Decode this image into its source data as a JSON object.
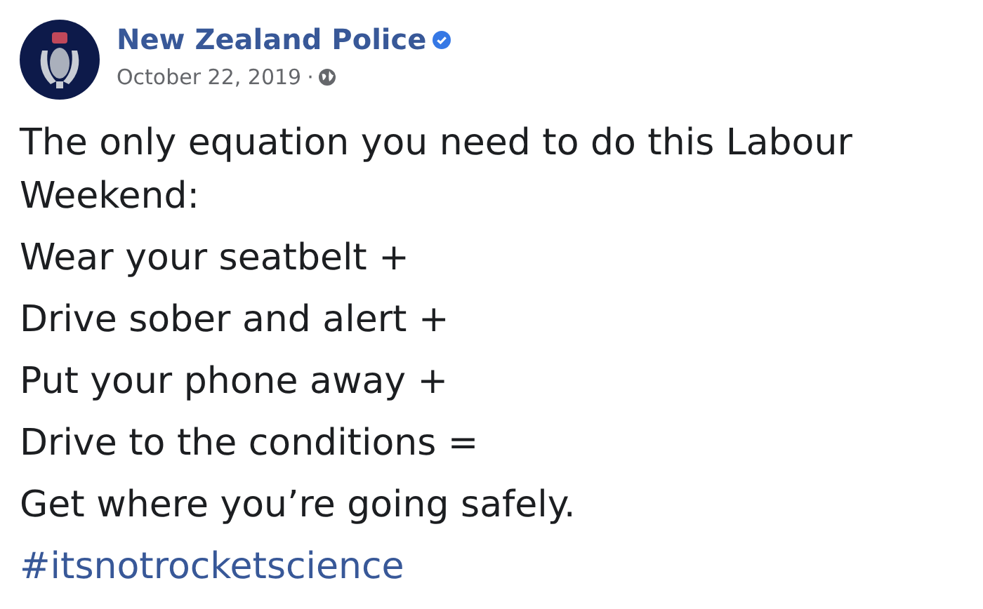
{
  "post": {
    "author": "New Zealand Police",
    "verified": true,
    "date": "October 22, 2019",
    "separator": "·",
    "paragraphs": [
      "The only equation you need to do this Labour Weekend:",
      "Wear your seatbelt +",
      "Drive sober and alert +",
      "Put your phone away +",
      "Drive to the conditions =",
      "Get where you’re going safely."
    ],
    "hashtag": "#itsnotrocketscience"
  }
}
